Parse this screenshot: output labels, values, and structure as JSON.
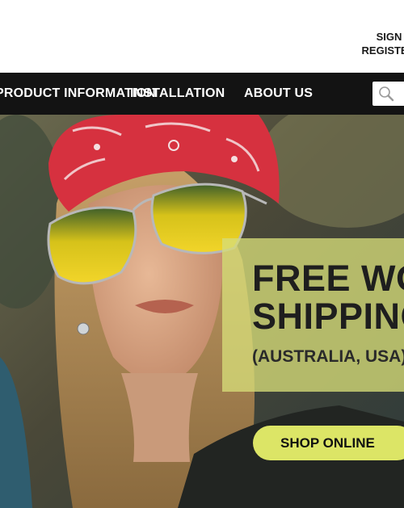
{
  "header": {
    "sign_in_label": "SIGN IN",
    "register_label": "REGISTER"
  },
  "nav": {
    "items": [
      {
        "label": "PRODUCT INFORMATION"
      },
      {
        "label": "INSTALLATION"
      },
      {
        "label": "ABOUT US"
      }
    ],
    "search_icon": "search-icon"
  },
  "hero": {
    "headline_line1": "FREE WORLDWIDE",
    "headline_line2": "SHIPPING",
    "subline": "(AUSTRALIA, USA)",
    "cta_label": "SHOP ONLINE"
  },
  "colors": {
    "nav_bg": "#131313",
    "promo_panel": "#d6dd78",
    "cta_bg": "#dce566"
  }
}
